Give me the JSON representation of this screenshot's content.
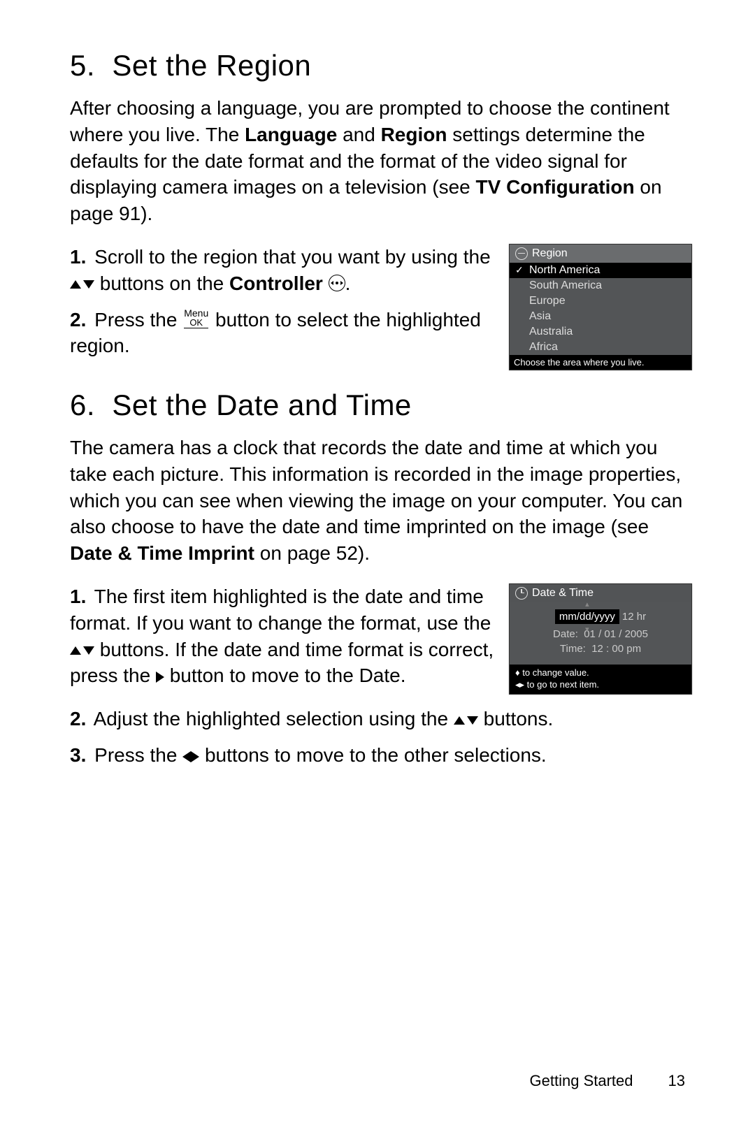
{
  "section5": {
    "num": "5.",
    "title": "Set the Region",
    "intro_1": "After choosing a language, you are prompted to choose the continent where you live. The ",
    "intro_b1": "Language",
    "intro_2": " and ",
    "intro_b2": "Region",
    "intro_3": " settings determine the defaults for the date format and the format of the video signal for displaying camera images on a television (see ",
    "intro_b3": "TV Configuration",
    "intro_4": " on page 91).",
    "step1_a": "Scroll to the region that you want by using the ",
    "step1_b": " buttons on the ",
    "step1_c": "Controller",
    "step1_d": " ",
    "step1_e": ".",
    "step2_a": "Press the ",
    "step2_b": " button to select the highlighted region.",
    "screen_title": "Region",
    "regions": [
      "North America",
      "South America",
      "Europe",
      "Asia",
      "Australia",
      "Africa"
    ],
    "screen_footer": "Choose the area where you live."
  },
  "section6": {
    "num": "6.",
    "title": "Set the Date and Time",
    "intro_1": "The camera has a clock that records the date and time at which you take each picture. This information is recorded in the image properties, which you can see when viewing the image on your computer. You can also choose to have the date and time imprinted on the image (see ",
    "intro_b1": "Date & Time Imprint",
    "intro_2": " on page 52).",
    "step1_a": "The first item highlighted is the date and time format. If you want to change the format, use the ",
    "step1_b": " buttons. If the date and time format is correct, press the ",
    "step1_c": " button to move to the Date.",
    "step2_a": "Adjust the highlighted selection using the ",
    "step2_b": " buttons.",
    "step3_a": "Press the ",
    "step3_b": " buttons to move to the other selections.",
    "screen_title": "Date & Time",
    "format": "mm/dd/yyyy",
    "hour_mode": "12 hr",
    "date_label": "Date:",
    "date_value": "01 / 01 / 2005",
    "time_label": "Time:",
    "time_value": "12 : 00  pm",
    "hint1": "to change value.",
    "hint2": "to go to next item."
  },
  "menu_label_top": "Menu",
  "menu_label_bottom": "OK",
  "footer_text": "Getting Started",
  "page_num": "13"
}
